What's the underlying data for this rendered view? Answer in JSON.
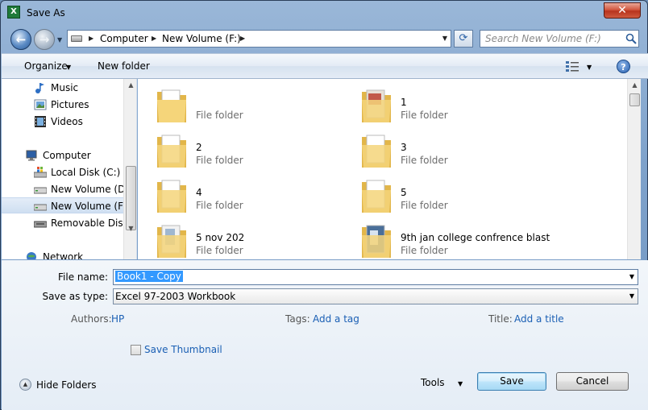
{
  "window": {
    "title": "Save As",
    "app_icon": "excel-icon",
    "close_glyph": "✕"
  },
  "address": {
    "back_glyph": "←",
    "forward_glyph": "→",
    "breadcrumbs": [
      "Computer",
      "New Volume (F:)"
    ],
    "refresh_glyph": "⟳",
    "search_placeholder": "Search New Volume (F:)"
  },
  "toolbar": {
    "organize_label": "Organize",
    "new_folder_label": "New folder",
    "help_glyph": "?"
  },
  "sidebar": {
    "items": [
      {
        "label": "Music",
        "icon": "music-icon"
      },
      {
        "label": "Pictures",
        "icon": "pictures-icon"
      },
      {
        "label": "Videos",
        "icon": "videos-icon"
      },
      {
        "label": "Computer",
        "icon": "computer-icon"
      },
      {
        "label": "Local Disk (C:)",
        "icon": "windows-drive-icon"
      },
      {
        "label": "New Volume (D:)",
        "icon": "drive-icon"
      },
      {
        "label": "New Volume (F:)",
        "icon": "drive-icon",
        "selected": true
      },
      {
        "label": "Removable Disk (",
        "icon": "removable-drive-icon"
      },
      {
        "label": "Network",
        "icon": "network-icon"
      }
    ]
  },
  "files": [
    {
      "name": "",
      "type": "File folder"
    },
    {
      "name": "1",
      "type": "File folder"
    },
    {
      "name": "2",
      "type": "File folder"
    },
    {
      "name": "3",
      "type": "File folder"
    },
    {
      "name": "4",
      "type": "File folder"
    },
    {
      "name": "5",
      "type": "File folder"
    },
    {
      "name": "5 nov 202",
      "type": "File folder"
    },
    {
      "name": "9th  jan college confrence blast",
      "type": "File folder"
    }
  ],
  "form": {
    "file_name_label": "File name:",
    "file_name_value": "Book1 - Copy",
    "save_type_label": "Save as type:",
    "save_type_value": "Excel 97-2003 Workbook",
    "authors_label": "Authors:",
    "authors_value": "HP",
    "tags_label": "Tags:",
    "tags_value": "Add a tag",
    "title_label": "Title:",
    "title_value": "Add a title",
    "thumbnail_label": "Save Thumbnail",
    "thumbnail_checked": false
  },
  "footer": {
    "hide_folders_label": "Hide Folders",
    "tools_label": "Tools",
    "save_label": "Save",
    "cancel_label": "Cancel"
  },
  "colors": {
    "selection": "#3399ff",
    "link": "#1a5fb4",
    "close_button": "#c8472d"
  }
}
